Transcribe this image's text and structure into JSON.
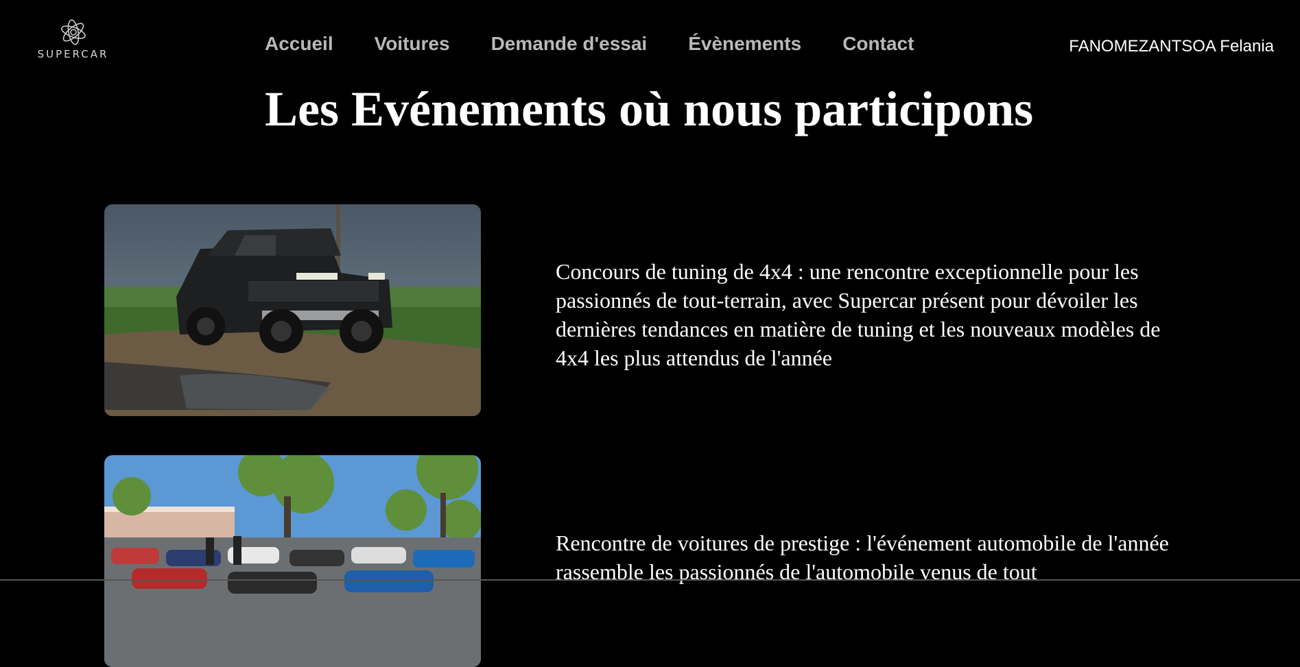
{
  "brand": {
    "logo_text": "SUPERCAR",
    "logo_icon": "swirl-logo-icon"
  },
  "nav": {
    "items": [
      {
        "label": "Accueil"
      },
      {
        "label": "Voitures"
      },
      {
        "label": "Demande d'essai"
      },
      {
        "label": "Évènements"
      },
      {
        "label": "Contact"
      }
    ]
  },
  "user": {
    "name": "FANOMEZANTSOA Felania"
  },
  "page": {
    "title": "Les Evénements où nous participons"
  },
  "events": [
    {
      "image": "4x4-truck-offroad-photo",
      "text": "Concours de tuning de 4x4 : une rencontre exceptionnelle pour les passionnés de tout-terrain, avec Supercar présent pour dévoiler les dernières tendances en matière de tuning et les nouveaux modèles de 4x4 les plus attendus de l'année"
    },
    {
      "image": "car-meet-parking-lot-photo",
      "text": "Rencontre de voitures de prestige : l'événement automobile de l'année rassemble les passionnés de l'automobile venus de tout"
    }
  ],
  "colors": {
    "background": "#000000",
    "nav_text": "#b9b9b9",
    "text": "#ffffff"
  }
}
